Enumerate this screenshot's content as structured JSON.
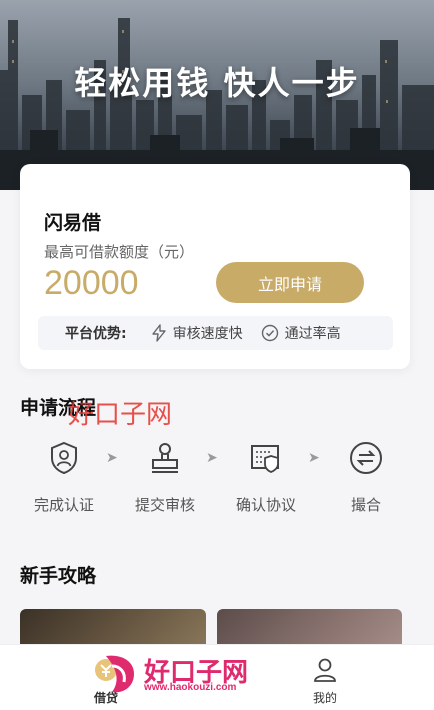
{
  "hero": {
    "title": "轻松用钱  快人一步"
  },
  "card": {
    "product_name": "闪易借",
    "limit_label": "最高可借款额度（元）",
    "limit_amount": "20000",
    "apply_label": "立即申请",
    "advantages": {
      "title": "平台优势:",
      "items": [
        {
          "icon": "lightning-icon",
          "label": "审核速度快"
        },
        {
          "icon": "check-circle-icon",
          "label": "通过率高"
        }
      ]
    }
  },
  "process": {
    "title": "申请流程",
    "steps": [
      {
        "icon": "shield-user-icon",
        "label": "完成认证"
      },
      {
        "icon": "stamp-icon",
        "label": "提交审核"
      },
      {
        "icon": "document-shield-icon",
        "label": "确认协议"
      },
      {
        "icon": "exchange-icon",
        "label": "撮合"
      }
    ],
    "arrow": "➤"
  },
  "watermark": {
    "text": "好口子网"
  },
  "guide": {
    "title": "新手攻略"
  },
  "tabbar": {
    "tabs": [
      {
        "icon": "loan-icon",
        "label": "借贷"
      },
      {
        "icon": "user-icon",
        "label": "我的"
      }
    ]
  },
  "logo_watermark": {
    "name": "好口子网",
    "url": "www.haokouzi.com"
  },
  "colors": {
    "accent": "#c9ab68",
    "watermark": "#e5342d",
    "logo": "#e02a6e"
  }
}
